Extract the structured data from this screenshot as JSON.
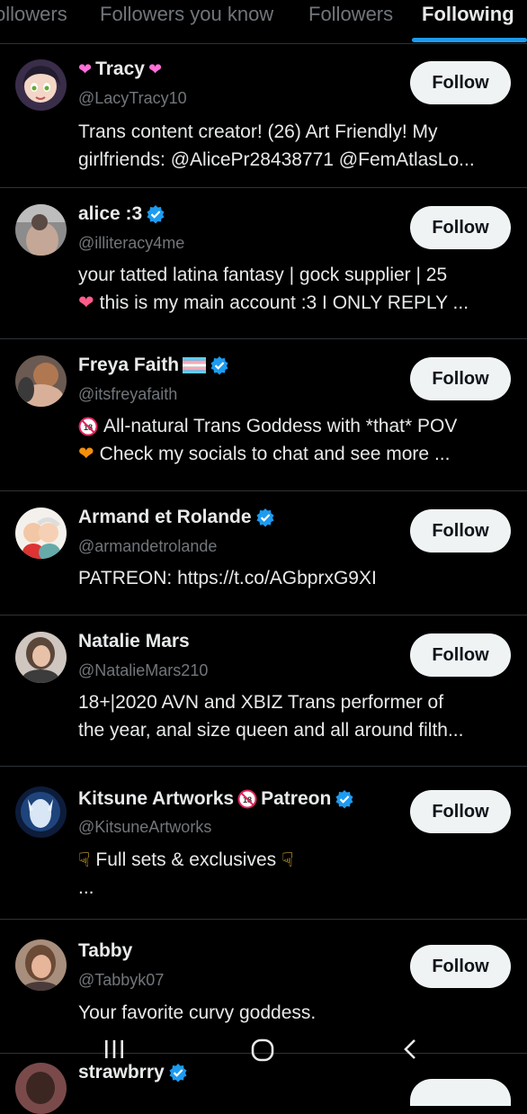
{
  "tabs": [
    {
      "label": "ollowers"
    },
    {
      "label": "Followers you know"
    },
    {
      "label": "Followers"
    },
    {
      "label": "Following"
    }
  ],
  "follow_label": "Follow",
  "accent": "#1d9bf0",
  "users": [
    {
      "name": "Tracy",
      "handle": "@LacyTracy10",
      "bio": [
        "Trans content creator! (26) Art Friendly! My",
        "girlfriends: @AlicePr28438771 @FemAtlasLo..."
      ]
    },
    {
      "name": "alice :3",
      "handle": "@illiteracy4me",
      "bio": [
        "your tatted latina fantasy | gock supplier | 25",
        "this is my main account :3 I ONLY REPLY ..."
      ]
    },
    {
      "name": "Freya Faith",
      "handle": "@itsfreyafaith",
      "bio": [
        "All-natural Trans Goddess with *that* POV",
        "Check my socials to chat and see more ..."
      ]
    },
    {
      "name": "Armand et Rolande",
      "handle": "@armandetrolande",
      "bio": [
        "PATREON: https://t.co/AGbprxG9XI"
      ]
    },
    {
      "name": "Natalie Mars",
      "handle": "@NatalieMars210",
      "bio": [
        "18+|2020 AVN and XBIZ Trans performer of",
        "the year, anal size queen and all around filth..."
      ]
    },
    {
      "name": "Kitsune Artworks",
      "name_suffix": "Patreon",
      "handle": "@KitsuneArtworks",
      "bio": [
        "Full sets & exclusives",
        "..."
      ]
    },
    {
      "name": "Tabby",
      "handle": "@Tabbyk07",
      "bio": [
        "Your favorite curvy goddess."
      ]
    },
    {
      "name": "strawbrry",
      "handle": "",
      "bio": []
    }
  ]
}
